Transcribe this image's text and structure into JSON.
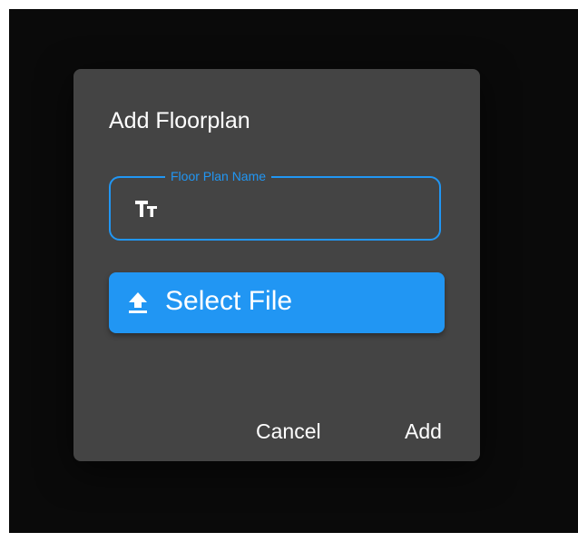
{
  "dialog": {
    "title": "Add Floorplan",
    "name_field": {
      "label": "Floor Plan Name",
      "value": "",
      "icon": "text-size-icon"
    },
    "select_file": {
      "label": "Select File",
      "icon": "upload-icon"
    },
    "actions": {
      "cancel_label": "Cancel",
      "add_label": "Add"
    }
  },
  "colors": {
    "backdrop": "#0a0a0a",
    "dialog_bg": "#444444",
    "accent": "#2196f3",
    "text": "#ffffff"
  }
}
